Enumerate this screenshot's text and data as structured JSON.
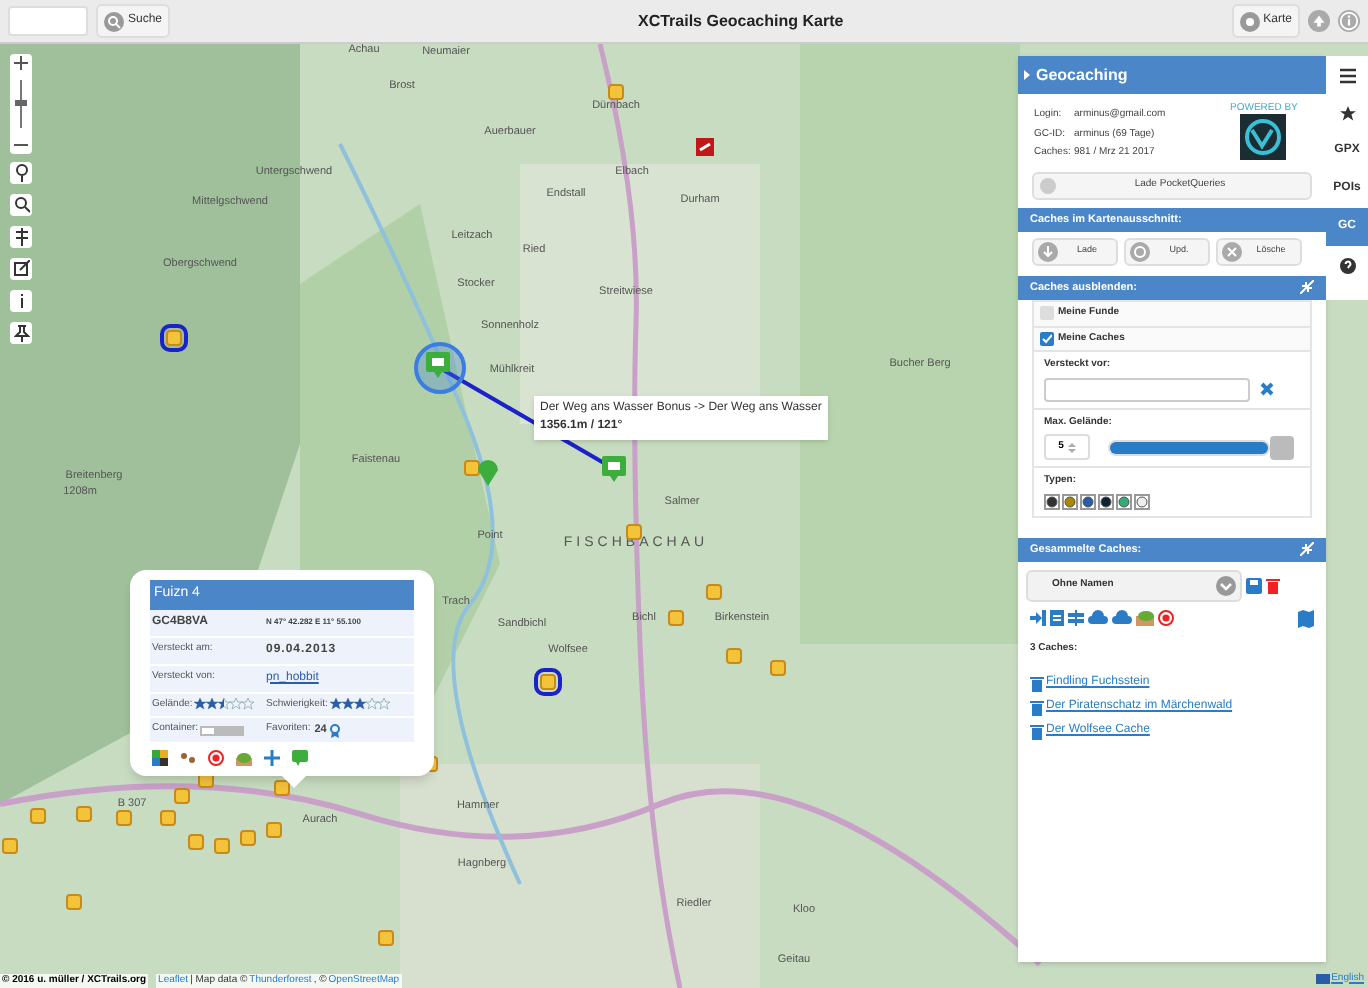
{
  "topbar": {
    "search_button": "Suche",
    "title": "XCTrails Geocaching Karte",
    "map_button": "Karte"
  },
  "map": {
    "labels": [
      "Achau",
      "Neumaier",
      "Brost",
      "Dürnbach",
      "Auerbauer",
      "Elbach",
      "Untergschwend",
      "Endstall",
      "Durham",
      "Mittelgschwend",
      "Ried",
      "Stocker",
      "Streitwiese",
      "Obergschwend",
      "Sonnenholz",
      "Mühlkreit",
      "Faistenau",
      "Breitenberg",
      "1208m",
      "Salmer",
      "Point",
      "FISCHBACHAU",
      "Trach",
      "Sandbichl",
      "Bichl",
      "Birkenstein",
      "Hammer",
      "Aurach",
      "Hagnberg",
      "Riedler",
      "Geitau",
      "Kloo",
      "Wolfsee",
      "B 307",
      "Bucher Berg",
      "Leitzach"
    ],
    "tooltip": {
      "title": "Der Weg ans Wasser Bonus -> Der Weg ans Wasser",
      "distance": "1356.1m / 121°"
    },
    "attribution": {
      "copyright": "© 2016 u. müller / XCTrails.org",
      "leaflet": "Leaflet",
      "data": "| Map data ©",
      "thunderforest": "Thunderforest",
      "separator": ", ©",
      "osm": "OpenStreetMap"
    }
  },
  "popup": {
    "title": "Fuizn 4",
    "code": "GC4B8VA",
    "coords": "N 47° 42.282 E 11° 55.100",
    "rows": [
      {
        "label": "Versteckt am:",
        "value": "09.04.2013",
        "kind": "text"
      },
      {
        "label": "Versteckt von:",
        "value": "pn_hobbit",
        "kind": "link"
      }
    ],
    "terrain": {
      "label": "Gelände:",
      "stars": 2.5
    },
    "difficulty": {
      "label": "Schwierigkeit:",
      "stars": 3
    },
    "container_label": "Container:",
    "favorites_label": "Favoriten:",
    "favorites": "24"
  },
  "panel": {
    "title": "Geocaching",
    "account": [
      {
        "label": "Login:",
        "value": "arminus@gmail.com"
      },
      {
        "label": "GC-ID:",
        "value": "arminus (69 Tage)"
      },
      {
        "label": "Caches:",
        "value": "981 / Mrz 21 2017"
      }
    ],
    "logo_caption": "POWERED BY",
    "pocket_button": "Lade PocketQueries",
    "section_view": "Caches im Kartenausschnitt:",
    "view_buttons": [
      {
        "label": "Lade",
        "kind": "load"
      },
      {
        "label": "Upd.",
        "kind": "update"
      },
      {
        "label": "Lösche",
        "kind": "delete"
      }
    ],
    "section_hide": "Caches ausblenden:",
    "hide_options": [
      {
        "label": "Meine Funde",
        "checked": false
      },
      {
        "label": "Meine Caches",
        "checked": true
      }
    ],
    "hidden_before_label": "Versteckt vor:",
    "terrain_label": "Max. Gelände:",
    "terrain_value": "5",
    "terrain_slider": {
      "level": 1.0
    },
    "types_label": "Typen:",
    "section_collected": "Gesammelte Caches:",
    "collection_select": "Ohne Namen",
    "count": "3 Caches:",
    "caches": [
      "Findling Fuchsstein",
      "Der Piratenschatz im Märchenwald",
      "Der Wolfsee Cache"
    ]
  },
  "tabs": [
    {
      "kind": "menu",
      "selected": false
    },
    {
      "kind": "star",
      "selected": false
    },
    {
      "label": "GPX",
      "kind": "text",
      "selected": false
    },
    {
      "label": "POIs",
      "kind": "text",
      "selected": false
    },
    {
      "label": "GC",
      "kind": "text",
      "selected": true
    },
    {
      "kind": "help",
      "selected": false
    }
  ],
  "language": "English"
}
